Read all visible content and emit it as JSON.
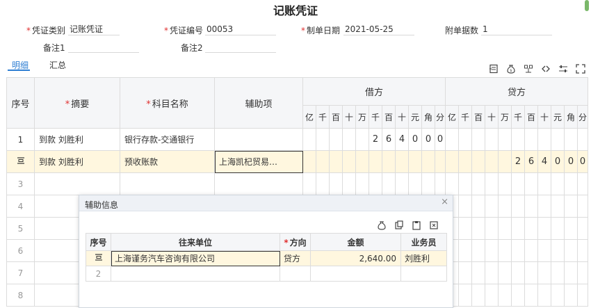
{
  "voucher": {
    "title": "记账凭证",
    "fields": {
      "category_label": "凭证类别",
      "category_value": "记账凭证",
      "number_label": "凭证编号",
      "number_value": "00053",
      "date_label": "制单日期",
      "date_value": "2021-05-25",
      "attachments_label": "附单据数",
      "attachments_value": "1",
      "memo1_label": "备注1",
      "memo1_value": "",
      "memo2_label": "备注2",
      "memo2_value": ""
    }
  },
  "tabs": [
    {
      "label": "明细",
      "active": true
    },
    {
      "label": "汇总",
      "active": false
    }
  ],
  "toolbar_icons": [
    "insert-row-icon",
    "money-bag-icon",
    "balance-icon",
    "link-icon",
    "settings-sliders-icon",
    "fullscreen-icon"
  ],
  "grid": {
    "headers": {
      "seq": "序号",
      "summary": "摘要",
      "account": "科目名称",
      "auxiliary": "辅助项",
      "debit": "借方",
      "credit": "贷方"
    },
    "digit_units": [
      "亿",
      "千",
      "百",
      "十",
      "万",
      "千",
      "百",
      "十",
      "元",
      "角",
      "分"
    ],
    "rows": [
      {
        "seq": "1",
        "summary": "到款   刘胜利",
        "account": "银行存款-交通银行",
        "auxiliary": "",
        "debit": [
          "",
          "",
          "",
          "",
          "",
          "2",
          "6",
          "4",
          "0",
          "0",
          "0"
        ],
        "credit": [
          "",
          "",
          "",
          "",
          "",
          "",
          "",
          "",
          "",
          "",
          ""
        ]
      },
      {
        "seq": "",
        "summary": "到款   刘胜利",
        "account": "预收账款",
        "auxiliary": "上海凯杞贸易…",
        "debit": [
          "",
          "",
          "",
          "",
          "",
          "",
          "",
          "",
          "",
          "",
          ""
        ],
        "credit": [
          "",
          "",
          "",
          "",
          "",
          "2",
          "6",
          "4",
          "0",
          "0",
          "0"
        ]
      },
      {
        "seq": "3"
      },
      {
        "seq": "4"
      },
      {
        "seq": "5"
      },
      {
        "seq": "6"
      },
      {
        "seq": "7"
      },
      {
        "seq": "8"
      }
    ]
  },
  "aux_dialog": {
    "title": "辅助信息",
    "close": "×",
    "icons": [
      "money-bag-icon",
      "copy-icon",
      "paste-icon",
      "clear-icon"
    ],
    "headers": {
      "seq": "序号",
      "partner": "往来单位",
      "direction": "方向",
      "amount": "金额",
      "salesperson": "业务员"
    },
    "rows": [
      {
        "seq": "",
        "partner": "上海谨务汽车咨询有限公司",
        "direction": "贷方",
        "amount": "2,640.00",
        "salesperson": "刘胜利"
      },
      {
        "seq": "2",
        "partner": "",
        "direction": "",
        "amount": "",
        "salesperson": ""
      }
    ]
  },
  "colors": {
    "accent": "#2f7fd3",
    "required": "#e03030",
    "selected_row": "#fff7df",
    "header_bg": "#f5f6f8"
  }
}
